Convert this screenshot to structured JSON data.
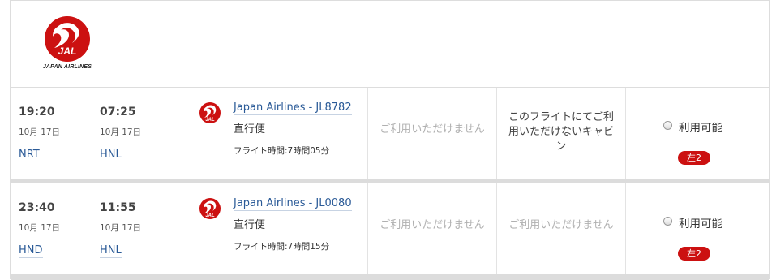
{
  "brand": {
    "logo_text": "JAL",
    "airline_wordmark": "JAPAN AIRLINES",
    "color": "#cc1111"
  },
  "flights": [
    {
      "dep_time": "19:20",
      "dep_date": "10月 17日",
      "dep_airport": "NRT",
      "arr_time": "07:25",
      "arr_date": "10月 17日",
      "arr_airport": "HNL",
      "flight_label": "Japan Airlines - JL8782",
      "nonstop": "直行便",
      "duration": "フライト時間:7時間05分",
      "col1": "ご利用いただけません",
      "col2": "このフライトにてご利用いただけないキャビン",
      "col3_label": "利用可能",
      "col3_seats": "左2"
    },
    {
      "dep_time": "23:40",
      "dep_date": "10月 17日",
      "dep_airport": "HND",
      "arr_time": "11:55",
      "arr_date": "10月 17日",
      "arr_airport": "HNL",
      "flight_label": "Japan Airlines - JL0080",
      "nonstop": "直行便",
      "duration": "フライト時間:7時間15分",
      "col1": "ご利用いただけません",
      "col2": "ご利用いただけません",
      "col3_label": "利用可能",
      "col3_seats": "左2"
    }
  ]
}
